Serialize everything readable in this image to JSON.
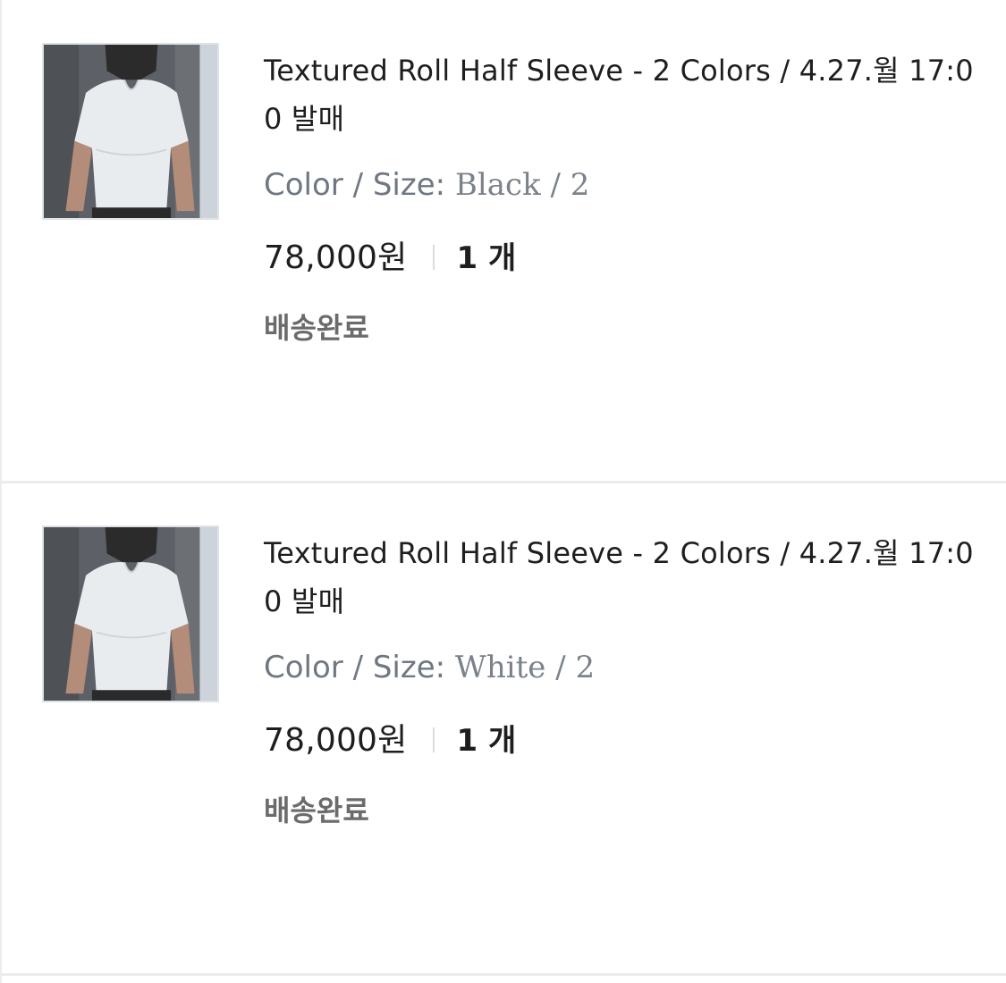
{
  "orders": [
    {
      "product_name": "Textured Roll Half Sleeve - 2 Colors / 4.27.월 17:00 발매",
      "option_label": "Color / Size:",
      "option_value": "Black / 2",
      "price": "78,000원",
      "quantity": "1 개",
      "status": "배송완료",
      "thumbnail_icon": "product-photo-white-tshirt"
    },
    {
      "product_name": "Textured Roll Half Sleeve - 2 Colors / 4.27.월 17:00 발매",
      "option_label": "Color / Size:",
      "option_value": "White / 2",
      "price": "78,000원",
      "quantity": "1 개",
      "status": "배송완료",
      "thumbnail_icon": "product-photo-white-tshirt"
    }
  ]
}
